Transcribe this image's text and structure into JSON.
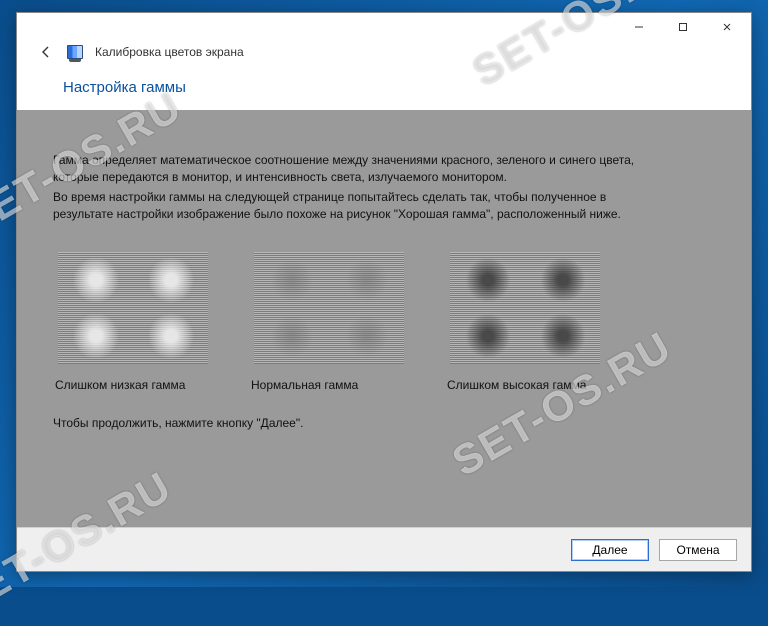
{
  "window": {
    "title": "Калибровка цветов экрана"
  },
  "page": {
    "heading": "Настройка гаммы"
  },
  "description": {
    "p1": "Гамма определяет математическое соотношение между значениями красного, зеленого и синего цвета, которые передаются в монитор, и интенсивность света, излучаемого монитором.",
    "p2": "Во время настройки гаммы на следующей странице попытайтесь сделать так, чтобы полученное в результате настройки изображение было похоже на рисунок \"Хорошая гамма\", расположенный ниже."
  },
  "samples": {
    "low": "Слишком низкая гамма",
    "mid": "Нормальная гамма",
    "high": "Слишком высокая гамма"
  },
  "continue_hint": "Чтобы продолжить, нажмите кнопку \"Далее\".",
  "buttons": {
    "next": "Далее",
    "cancel": "Отмена"
  },
  "watermark": "SET-OS.RU"
}
